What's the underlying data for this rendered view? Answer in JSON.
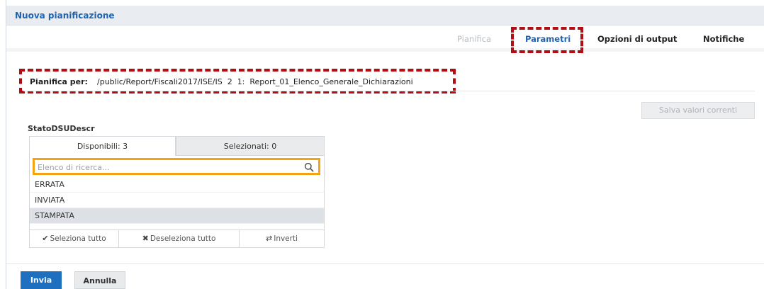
{
  "header": {
    "title": "Nuova pianificazione"
  },
  "tabs": [
    {
      "label": "Pianifica",
      "state": "disabled"
    },
    {
      "label": "Parametri",
      "state": "active"
    },
    {
      "label": "Opzioni di output",
      "state": "normal"
    },
    {
      "label": "Notifiche",
      "state": "normal"
    }
  ],
  "schedule": {
    "label": "Pianifica per:",
    "path": "/public/Report/Fiscali2017/ISE/IS  2  1:  Report_01_Elenco_Generale_Dichiarazioni"
  },
  "save_button": {
    "label": "Salva valori correnti"
  },
  "parameter": {
    "name": "StatoDSUDescr",
    "tab_available": "Disponibili: 3",
    "tab_selected": "Selezionati: 0",
    "search_placeholder": "Elenco di ricerca...",
    "items": [
      "ERRATA",
      "INVIATA",
      "STAMPATA"
    ],
    "actions": {
      "select_all": "Seleziona tutto",
      "deselect_all": "Deseleziona tutto",
      "invert": "Inverti"
    }
  },
  "footer": {
    "submit": "Invia",
    "cancel": "Annulla"
  },
  "colors": {
    "accent": "#1f6fc1",
    "highlight_red": "#b10e13",
    "highlight_orange": "#f2a413"
  },
  "icons": {
    "search": "search-icon",
    "select_all": "check-icon",
    "deselect_all": "x-icon",
    "invert": "invert-icon"
  }
}
